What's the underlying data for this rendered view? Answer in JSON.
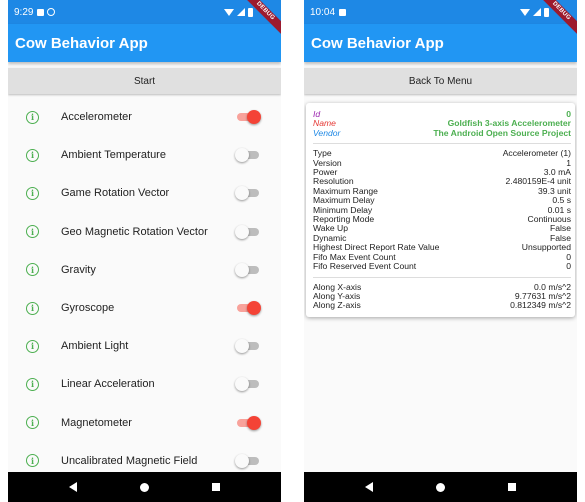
{
  "left": {
    "status": {
      "time": "9:29"
    },
    "app_title": "Cow Behavior App",
    "debug_banner": "DEBUG",
    "top_button": "Start",
    "sensors": [
      {
        "name": "Accelerometer",
        "enabled": true
      },
      {
        "name": "Ambient Temperature",
        "enabled": false
      },
      {
        "name": "Game Rotation Vector",
        "enabled": false
      },
      {
        "name": "Geo Magnetic Rotation Vector",
        "enabled": false
      },
      {
        "name": "Gravity",
        "enabled": false
      },
      {
        "name": "Gyroscope",
        "enabled": true
      },
      {
        "name": "Ambient Light",
        "enabled": false
      },
      {
        "name": "Linear Acceleration",
        "enabled": false
      },
      {
        "name": "Magnetometer",
        "enabled": true
      },
      {
        "name": "Uncalibrated Magnetic Field",
        "enabled": false
      }
    ],
    "info_glyph": "i"
  },
  "right": {
    "status": {
      "time": "10:04"
    },
    "app_title": "Cow Behavior App",
    "debug_banner": "DEBUG",
    "top_button": "Back To Menu",
    "header": [
      {
        "label": "Id",
        "value": "0"
      },
      {
        "label": "Name",
        "value": "Goldfish 3-axis Accelerometer"
      },
      {
        "label": "Vendor",
        "value": "The Android Open Source Project"
      }
    ],
    "details": [
      {
        "label": "Type",
        "value": "Accelerometer (1)"
      },
      {
        "label": "Version",
        "value": "1"
      },
      {
        "label": "Power",
        "value": "3.0 mA"
      },
      {
        "label": "Resolution",
        "value": "2.480159E-4 unit"
      },
      {
        "label": "Maximum Range",
        "value": "39.3 unit"
      },
      {
        "label": "Maximum Delay",
        "value": "0.5 s"
      },
      {
        "label": "Minimum Delay",
        "value": "0.01 s"
      },
      {
        "label": "Reporting Mode",
        "value": "Continuous"
      },
      {
        "label": "Wake Up",
        "value": "False"
      },
      {
        "label": "Dynamic",
        "value": "False"
      },
      {
        "label": "Highest Direct Report Rate Value",
        "value": "Unsupported"
      },
      {
        "label": "Fifo Max Event Count",
        "value": "0"
      },
      {
        "label": "Fifo Reserved Event Count",
        "value": "0"
      }
    ],
    "readings": [
      {
        "label": "Along X-axis",
        "value": "0.0 m/s^2"
      },
      {
        "label": "Along Y-axis",
        "value": "9.77631 m/s^2"
      },
      {
        "label": "Along Z-axis",
        "value": "0.812349 m/s^2"
      }
    ]
  },
  "colors": {
    "app_bar": "#2196f3",
    "status_bar": "#1e88e5",
    "switch_on": "#f44336",
    "info_icon": "#4caf50",
    "header_value": "#4caf50",
    "label_id": "#9c27b0",
    "label_name": "#e53935",
    "label_vendor": "#1e88e5"
  },
  "icons": [
    "info-icon",
    "wifi-icon",
    "signal-icon",
    "battery-icon",
    "nav-back-icon",
    "nav-home-icon",
    "nav-recent-icon"
  ]
}
